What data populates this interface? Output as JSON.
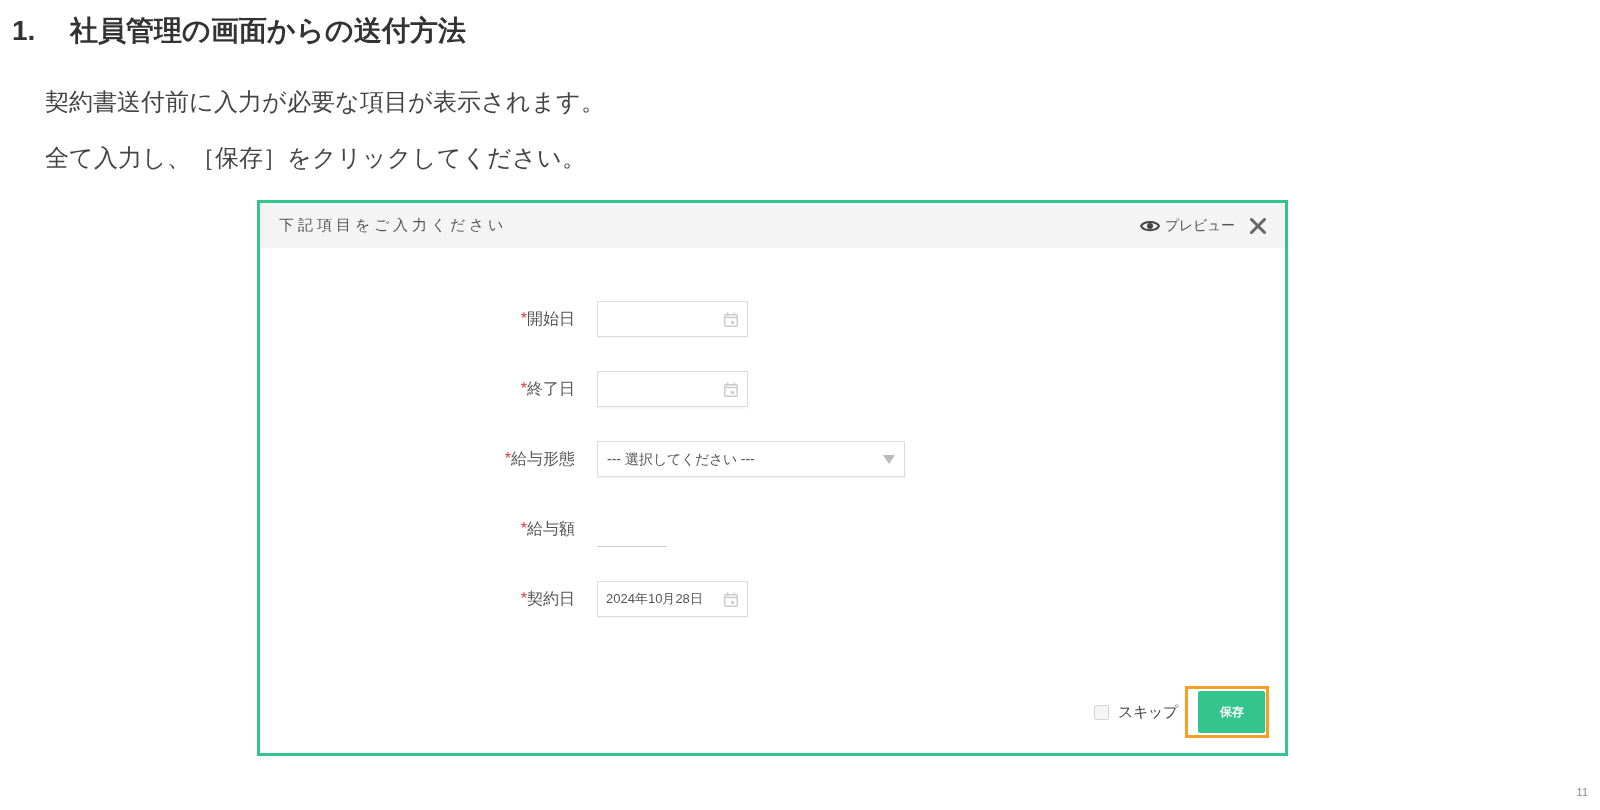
{
  "heading": {
    "number": "1.",
    "title": "社員管理の画面からの送付方法"
  },
  "instructions": [
    "契約書送付前に入力が必要な項目が表示されます。",
    "全て入力し、［保存］をクリックしてください。"
  ],
  "dialog": {
    "title": "下記項目をご入力ください",
    "preview_label": "プレビュー",
    "fields": [
      {
        "kind": "date",
        "required_mark": "*",
        "label": "開始日"
      },
      {
        "kind": "date",
        "required_mark": "*",
        "label": "終了日"
      },
      {
        "kind": "select",
        "required_mark": "*",
        "label": "給与形態",
        "placeholder": "--- 選択してください ---"
      },
      {
        "kind": "text",
        "required_mark": "*",
        "label": "給与額"
      },
      {
        "kind": "date",
        "required_mark": "*",
        "label": "契約日",
        "value": "2024年10月28日"
      }
    ],
    "skip": {
      "label": "スキップ",
      "checked": false
    },
    "save_button": {
      "label": "保存",
      "highlighted": true
    }
  },
  "page_number": "11"
}
